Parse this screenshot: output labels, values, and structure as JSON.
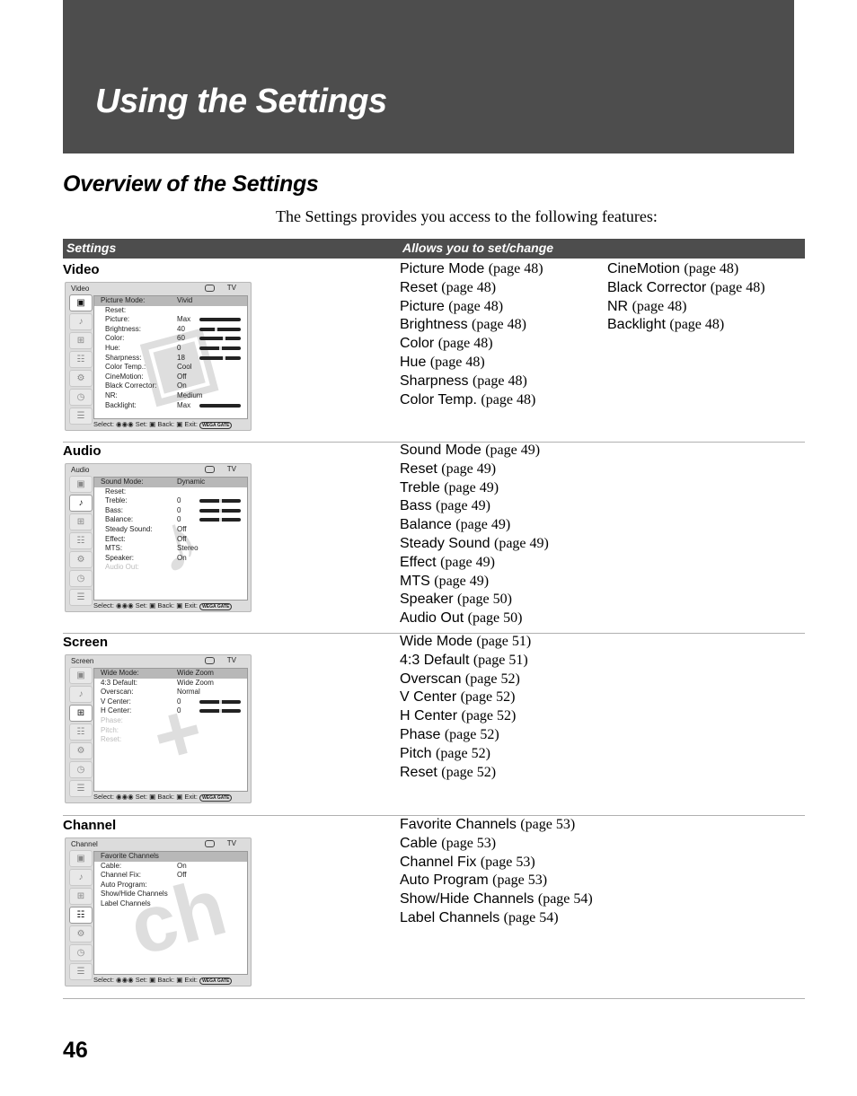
{
  "banner": {
    "title": "Using the Settings"
  },
  "section": {
    "title": "Overview of the Settings",
    "intro": "The Settings provides you access to the following features:"
  },
  "table": {
    "headers": [
      "Settings",
      "Allows you to set/change"
    ],
    "rows": [
      {
        "label": "Video",
        "features_col1": [
          {
            "name": "Picture Mode",
            "page": "(page 48)"
          },
          {
            "name": "Reset",
            "page": "(page 48)"
          },
          {
            "name": "Picture",
            "page": "(page 48)"
          },
          {
            "name": "Brightness",
            "page": "(page 48)"
          },
          {
            "name": "Color",
            "page": "(page 48)"
          },
          {
            "name": "Hue",
            "page": "(page 48)"
          },
          {
            "name": "Sharpness",
            "page": "(page 48)"
          },
          {
            "name": "Color Temp.",
            "page": "(page 48)"
          }
        ],
        "features_col2": [
          {
            "name": "CineMotion",
            "page": "(page 48)"
          },
          {
            "name": "Black Corrector",
            "page": "(page 48)"
          },
          {
            "name": "NR",
            "page": "(page 48)"
          },
          {
            "name": "Backlight",
            "page": "(page 48)"
          }
        ],
        "menu": {
          "title": "Video",
          "input": "TV",
          "active_icon": 0,
          "watermark": "picture",
          "items": [
            {
              "label": "Picture Mode:",
              "value": "Vivid",
              "highlight": true
            },
            {
              "label": "Reset:",
              "value": "",
              "indent": true
            },
            {
              "label": "Picture:",
              "value": "Max",
              "indent": true,
              "slider": 1.0
            },
            {
              "label": "Brightness:",
              "value": "40",
              "indent": true,
              "slider": 0.4
            },
            {
              "label": "Color:",
              "value": "60",
              "indent": true,
              "slider": 0.6
            },
            {
              "label": "Hue:",
              "value": "0",
              "indent": true,
              "slider": 0.5
            },
            {
              "label": "Sharpness:",
              "value": "18",
              "indent": true,
              "slider": 0.6
            },
            {
              "label": "Color  Temp.:",
              "value": "Cool",
              "indent": true
            },
            {
              "label": "CineMotion:",
              "value": "Off",
              "indent": true
            },
            {
              "label": "Black  Corrector:",
              "value": "On",
              "indent": true
            },
            {
              "label": "NR:",
              "value": "Medium",
              "indent": true
            },
            {
              "label": "Backlight:",
              "value": "Max",
              "indent": true,
              "slider": 1.0
            }
          ]
        }
      },
      {
        "label": "Audio",
        "features_col1": [
          {
            "name": "Sound Mode",
            "page": "(page 49)"
          },
          {
            "name": "Reset",
            "page": "(page 49)"
          },
          {
            "name": "Treble",
            "page": "(page 49)"
          },
          {
            "name": "Bass",
            "page": "(page 49)"
          },
          {
            "name": "Balance",
            "page": "(page 49)"
          },
          {
            "name": "Steady Sound",
            "page": "(page 49)"
          },
          {
            "name": "Effect",
            "page": "(page 49)"
          },
          {
            "name": "MTS",
            "page": "(page 49)"
          },
          {
            "name": "Speaker",
            "page": "(page 50)"
          },
          {
            "name": "Audio Out",
            "page": "(page 50)"
          }
        ],
        "features_col2": [],
        "menu": {
          "title": "Audio",
          "input": "TV",
          "active_icon": 1,
          "watermark": "music-note",
          "items": [
            {
              "label": "Sound  Mode:",
              "value": "Dynamic",
              "highlight": true
            },
            {
              "label": "Reset:",
              "value": "",
              "indent": true
            },
            {
              "label": "Treble:",
              "value": "0",
              "indent": true,
              "slider": 0.5
            },
            {
              "label": "Bass:",
              "value": "0",
              "indent": true,
              "slider": 0.5
            },
            {
              "label": "Balance:",
              "value": "0",
              "indent": true,
              "slider": 0.5
            },
            {
              "label": "Steady  Sound:",
              "value": "Off",
              "indent": true
            },
            {
              "label": "Effect:",
              "value": "Off",
              "indent": true
            },
            {
              "label": "MTS:",
              "value": "Stereo",
              "indent": true
            },
            {
              "label": "Speaker:",
              "value": "On",
              "indent": true
            },
            {
              "label": "Audio  Out:",
              "value": "",
              "indent": true,
              "disabled": true
            }
          ]
        }
      },
      {
        "label": "Screen",
        "features_col1": [
          {
            "name": "Wide Mode",
            "page": "(page 51)"
          },
          {
            "name": "4:3 Default",
            "page": "(page 51)"
          },
          {
            "name": "Overscan",
            "page": "(page 52)"
          },
          {
            "name": "V Center",
            "page": "(page 52)"
          },
          {
            "name": "H Center",
            "page": "(page 52)"
          },
          {
            "name": "Phase",
            "page": "(page 52)"
          },
          {
            "name": "Pitch",
            "page": "(page 52)"
          },
          {
            "name": "Reset",
            "page": "(page 52)"
          }
        ],
        "features_col2": [],
        "menu": {
          "title": "Screen",
          "input": "TV",
          "active_icon": 2,
          "watermark": "screen-plus",
          "items": [
            {
              "label": "Wide  Mode:",
              "value": "Wide  Zoom",
              "highlight": true
            },
            {
              "label": "4:3  Default:",
              "value": "Wide  Zoom"
            },
            {
              "label": "Overscan:",
              "value": "Normal"
            },
            {
              "label": "V  Center:",
              "value": "0",
              "slider": 0.5
            },
            {
              "label": "H  Center:",
              "value": "0",
              "slider": 0.5
            },
            {
              "label": "Phase:",
              "value": "",
              "disabled": true
            },
            {
              "label": "Pitch:",
              "value": "",
              "disabled": true
            },
            {
              "label": "Reset:",
              "value": "",
              "disabled": true
            }
          ]
        }
      },
      {
        "label": "Channel",
        "features_col1": [
          {
            "name": "Favorite Channels",
            "page": "(page 53)"
          },
          {
            "name": "Cable",
            "page": "(page 53)"
          },
          {
            "name": "Channel Fix",
            "page": "(page 53)"
          },
          {
            "name": "Auto Program",
            "page": "(page 53)"
          },
          {
            "name": "Show/Hide Channels",
            "page": "(page 54)"
          },
          {
            "name": "Label Channels",
            "page": "(page 54)"
          }
        ],
        "features_col2": [],
        "menu": {
          "title": "Channel",
          "input": "TV",
          "active_icon": 3,
          "watermark": "ch",
          "items": [
            {
              "label": "Favorite  Channels",
              "value": "",
              "highlight": true
            },
            {
              "label": "Cable:",
              "value": "On"
            },
            {
              "label": "Channel  Fix:",
              "value": "Off"
            },
            {
              "label": "Auto  Program:",
              "value": ""
            },
            {
              "label": "Show/Hide  Channels",
              "value": ""
            },
            {
              "label": "Label  Channels",
              "value": ""
            }
          ]
        }
      }
    ]
  },
  "menu_footer": {
    "select": "Select:",
    "set": "Set:",
    "back": "Back:",
    "exit": "Exit:",
    "exit_button": "WEGA GATE"
  },
  "sidebar_icons": [
    "video-icon",
    "audio-icon",
    "screen-icon",
    "channel-icon",
    "parental-lock-icon",
    "timer-icon",
    "setup-icon"
  ],
  "page_number": "46"
}
